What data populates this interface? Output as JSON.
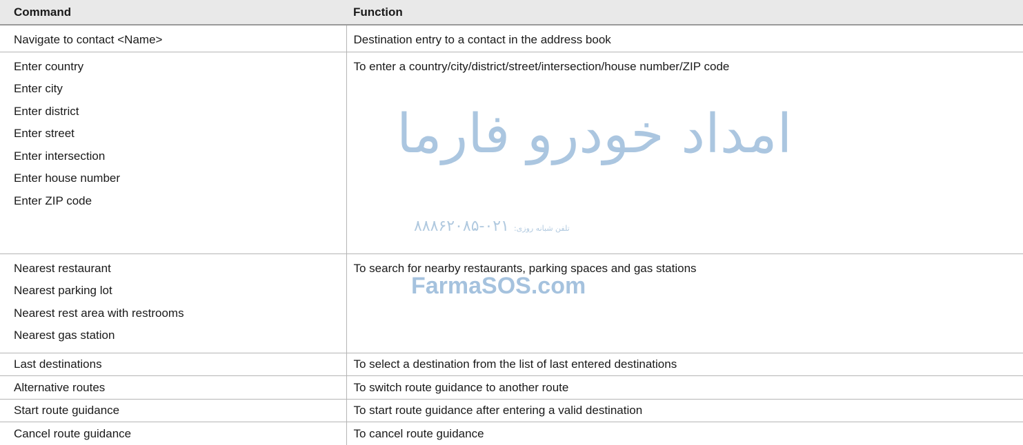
{
  "table": {
    "headers": {
      "command": "Command",
      "function": "Function"
    },
    "rows": [
      {
        "commands": [
          "Navigate to contact <Name>"
        ],
        "function": "Destination entry to a contact in the address book"
      },
      {
        "commands": [
          "Enter country",
          "Enter city",
          "Enter district",
          "Enter street",
          "Enter intersection",
          "Enter house number",
          "Enter ZIP code"
        ],
        "function": "To enter a country/city/district/street/intersection/house number/ZIP code"
      },
      {
        "commands": [
          "Nearest restaurant",
          "Nearest parking lot",
          "Nearest rest area with restrooms",
          "Nearest gas station"
        ],
        "function": "To search for nearby restaurants, parking spaces and gas stations"
      },
      {
        "commands": [
          "Last destinations"
        ],
        "function": "To select a destination from the list of last entered destinations"
      },
      {
        "commands": [
          "Alternative routes"
        ],
        "function": "To switch route guidance to another route"
      },
      {
        "commands": [
          "Start route guidance"
        ],
        "function": "To start route guidance after entering a valid destination"
      },
      {
        "commands": [
          "Cancel route guidance"
        ],
        "function": "To cancel route guidance"
      }
    ]
  },
  "watermark": {
    "persian_name": "امداد خودرو فارما",
    "phone_label": "تلفن شبانه روزی:",
    "phone_number": "۰۲۱-۸۸۸۶۲۰۸۵",
    "site": "FarmaSOS.com",
    "color": "#8fb4d6"
  }
}
